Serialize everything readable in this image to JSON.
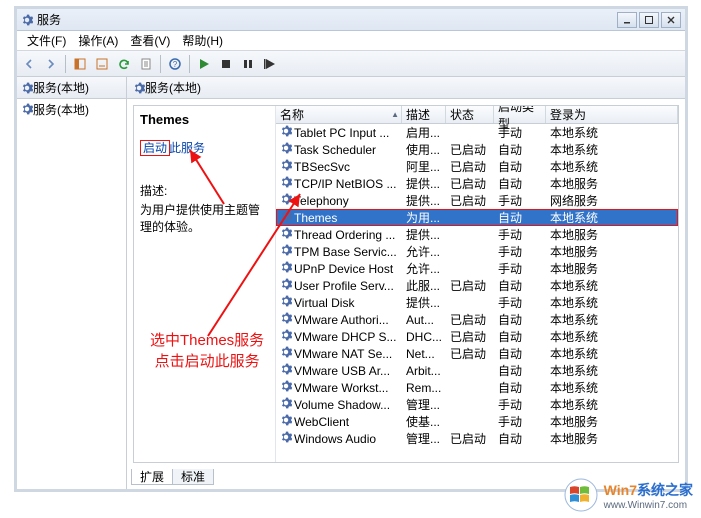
{
  "window": {
    "title": "服务"
  },
  "menubar": {
    "file": "文件(F)",
    "action": "操作(A)",
    "view": "查看(V)",
    "help": "帮助(H)"
  },
  "nav": {
    "header": "服务(本地)",
    "item": "服务(本地)"
  },
  "main": {
    "header": "服务(本地)"
  },
  "detail": {
    "serviceName": "Themes",
    "startLinkPrefix": "启动",
    "startLinkSuffix": "此服务",
    "descLabel": "描述:",
    "descText": "为用户提供使用主题管理的体验。"
  },
  "columns": {
    "name": "名称",
    "desc": "描述",
    "state": "状态",
    "startup": "启动类型",
    "logon": "登录为"
  },
  "services": [
    {
      "name": "Tablet PC Input ...",
      "desc": "启用...",
      "state": "",
      "startup": "手动",
      "logon": "本地系统"
    },
    {
      "name": "Task Scheduler",
      "desc": "使用...",
      "state": "已启动",
      "startup": "自动",
      "logon": "本地系统"
    },
    {
      "name": "TBSecSvc",
      "desc": "阿里...",
      "state": "已启动",
      "startup": "自动",
      "logon": "本地系统"
    },
    {
      "name": "TCP/IP NetBIOS ...",
      "desc": "提供...",
      "state": "已启动",
      "startup": "自动",
      "logon": "本地服务"
    },
    {
      "name": "Telephony",
      "desc": "提供...",
      "state": "已启动",
      "startup": "手动",
      "logon": "网络服务"
    },
    {
      "name": "Themes",
      "desc": "为用...",
      "state": "",
      "startup": "自动",
      "logon": "本地系统",
      "selected": true
    },
    {
      "name": "Thread Ordering ...",
      "desc": "提供...",
      "state": "",
      "startup": "手动",
      "logon": "本地服务"
    },
    {
      "name": "TPM Base Servic...",
      "desc": "允许...",
      "state": "",
      "startup": "手动",
      "logon": "本地服务"
    },
    {
      "name": "UPnP Device Host",
      "desc": "允许...",
      "state": "",
      "startup": "手动",
      "logon": "本地服务"
    },
    {
      "name": "User Profile Serv...",
      "desc": "此服...",
      "state": "已启动",
      "startup": "自动",
      "logon": "本地系统"
    },
    {
      "name": "Virtual Disk",
      "desc": "提供...",
      "state": "",
      "startup": "手动",
      "logon": "本地系统"
    },
    {
      "name": "VMware Authori...",
      "desc": "Aut...",
      "state": "已启动",
      "startup": "自动",
      "logon": "本地系统"
    },
    {
      "name": "VMware DHCP S...",
      "desc": "DHC...",
      "state": "已启动",
      "startup": "自动",
      "logon": "本地系统"
    },
    {
      "name": "VMware NAT Se...",
      "desc": "Net...",
      "state": "已启动",
      "startup": "自动",
      "logon": "本地系统"
    },
    {
      "name": "VMware USB Ar...",
      "desc": "Arbit...",
      "state": "",
      "startup": "自动",
      "logon": "本地系统"
    },
    {
      "name": "VMware Workst...",
      "desc": "Rem...",
      "state": "",
      "startup": "自动",
      "logon": "本地系统"
    },
    {
      "name": "Volume Shadow...",
      "desc": "管理...",
      "state": "",
      "startup": "手动",
      "logon": "本地系统"
    },
    {
      "name": "WebClient",
      "desc": "使基...",
      "state": "",
      "startup": "手动",
      "logon": "本地服务"
    },
    {
      "name": "Windows Audio",
      "desc": "管理...",
      "state": "已启动",
      "startup": "自动",
      "logon": "本地服务"
    }
  ],
  "tabs": {
    "extended": "扩展",
    "standard": "标准"
  },
  "annotation": {
    "line1": "选中Themes服务",
    "line2": "点击启动此服务"
  },
  "watermark": {
    "brand1": "Win7",
    "brand2": "系统之家",
    "sub": "www.Winwin7.com"
  }
}
